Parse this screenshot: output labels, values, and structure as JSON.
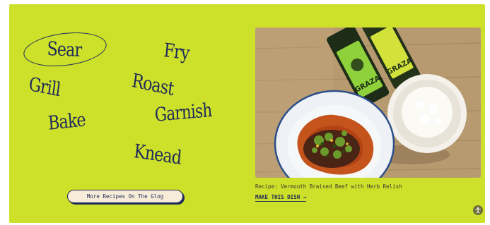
{
  "cooking_words": {
    "sear": "Sear",
    "fry": "Fry",
    "grill": "Grill",
    "roast": "Roast",
    "bake": "Bake",
    "garnish": "Garnish",
    "knead": "Knead"
  },
  "glog_button": {
    "label": "More Recipes On The Glog"
  },
  "recipe": {
    "caption": "Recipe: Vermouth Braised Beef with Herb Relish",
    "cta_label": "MAKE THIS DISH →"
  },
  "photo": {
    "bottle_label_1": "GRAZA",
    "bottle_label_2": "GRAZA"
  },
  "colors": {
    "background": "#cde02a",
    "ink": "#1f2a5a",
    "button_fill": "#f7ecd8"
  },
  "icons": {
    "accessibility": "accessibility-icon"
  }
}
